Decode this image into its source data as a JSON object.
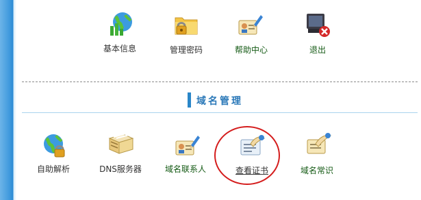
{
  "top_menu": {
    "items": [
      {
        "label": "基本信息",
        "icon": "globe-chart-icon"
      },
      {
        "label": "管理密码",
        "icon": "folder-lock-icon"
      },
      {
        "label": "帮助中心",
        "icon": "help-card-pen-icon"
      },
      {
        "label": "退出",
        "icon": "logout-computer-icon"
      }
    ]
  },
  "domain_section": {
    "title": "域名管理",
    "items": [
      {
        "label": "自助解析",
        "icon": "globe-lock-icon"
      },
      {
        "label": "DNS服务器",
        "icon": "server-stack-icon"
      },
      {
        "label": "域名联系人",
        "icon": "contact-card-icon"
      },
      {
        "label": "查看证书",
        "icon": "certificate-icon",
        "highlighted": true
      },
      {
        "label": "域名常识",
        "icon": "knowledge-note-icon"
      }
    ]
  },
  "colors": {
    "accent_blue": "#2a86c8",
    "highlight_red": "#d41c1c",
    "label_green": "#145a14"
  }
}
